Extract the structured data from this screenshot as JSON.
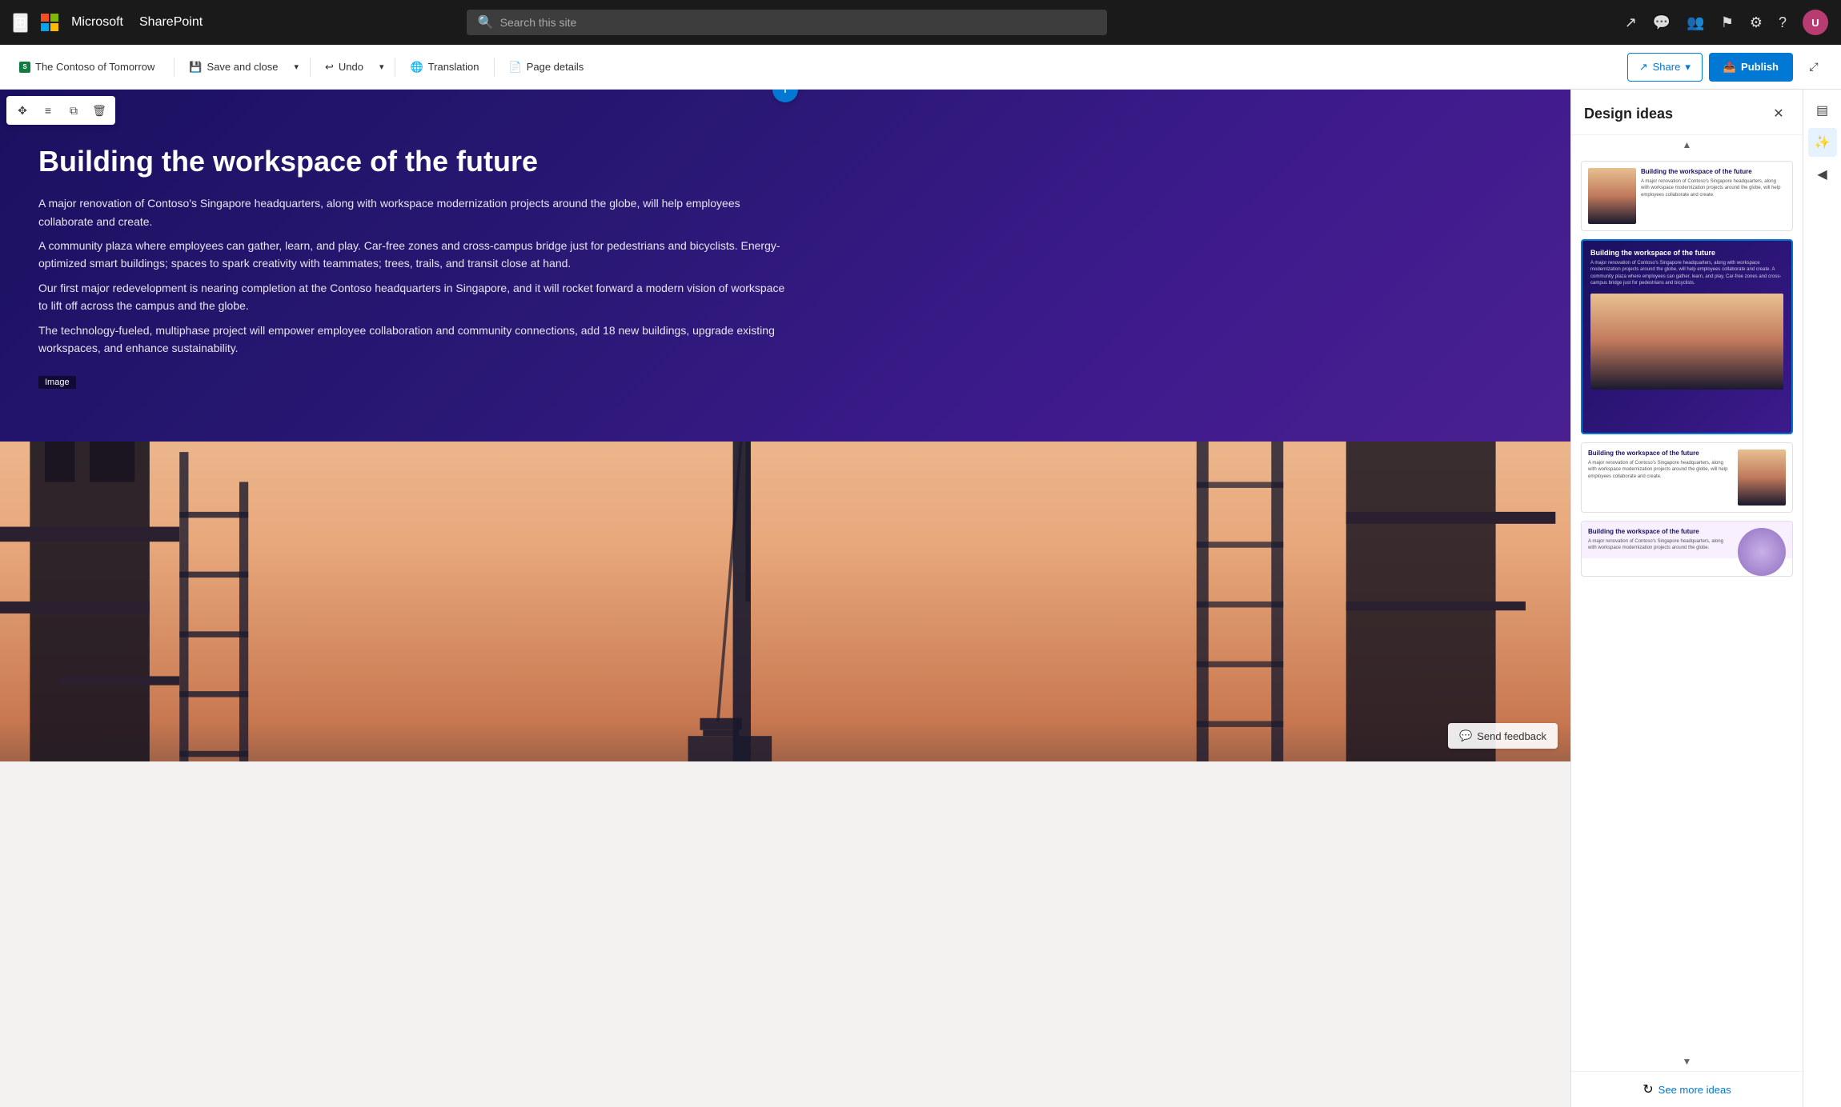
{
  "topnav": {
    "company": "Microsoft",
    "app": "SharePoint",
    "search_placeholder": "Search this site",
    "avatar_initials": "U"
  },
  "toolbar": {
    "brand_label": "The Contoso of Tomorrow",
    "save_close_label": "Save and close",
    "undo_label": "Undo",
    "translation_label": "Translation",
    "page_details_label": "Page details",
    "share_label": "Share",
    "publish_label": "Publish"
  },
  "hero": {
    "title": "Building the workspace of the future",
    "para1": "A major renovation of Contoso's Singapore headquarters, along with workspace modernization projects around the globe, will help employees collaborate and create.",
    "para2": "A community plaza where employees can gather, learn, and play. Car-free zones and cross-campus bridge just for pedestrians and bicyclists. Energy-optimized smart buildings; spaces to spark creativity with teammates; trees, trails, and transit close at hand.",
    "para3": "Our first major redevelopment is nearing completion at the Contoso headquarters in Singapore, and it will rocket forward a modern vision of workspace to lift off across the campus and the globe.",
    "para4": "The technology-fueled, multiphase project will empower employee collaboration and community connections, add 18 new buildings, upgrade existing workspaces, and enhance sustainability.",
    "image_label": "Image",
    "send_feedback_label": "Send feedback"
  },
  "design_panel": {
    "title": "Design ideas",
    "see_more_label": "See more ideas",
    "card1_title": "Building the workspace of the future",
    "card1_text": "A major renovation of Contoso's Singapore headquarters, along with workspace modernization projects around the globe, will help employees collaborate and create.",
    "card2_title": "Building the workspace of the future",
    "card2_text": "A major renovation of Contoso's Singapore headquarters, along with workspace modernization projects around the globe, will help employees collaborate and create. A community plaza where employees can gather, learn, and play. Car-free zones and cross-campus bridge just for pedestrians and bicyclists.",
    "card3_title": "Building the workspace of the future",
    "card3_text": "A major renovation of Contoso's Singapore headquarters, along with workspace modernization projects around the globe, will help employees collaborate and create.",
    "card4_title": "Building the workspace of the future",
    "card4_text": "A major renovation of Contoso's Singapore headquarters, along with workspace modernization projects around the globe."
  },
  "icons": {
    "grid": "⊞",
    "search": "🔍",
    "share_nav": "↗",
    "comment": "💬",
    "people": "👥",
    "flag": "⚑",
    "settings": "⚙",
    "help": "?",
    "save": "💾",
    "undo": "↩",
    "translate": "🌐",
    "page": "📄",
    "share_toolbar": "↗",
    "publish_icon": "📤",
    "chevron_down": "▾",
    "close": "✕",
    "move": "✥",
    "settings2": "≡",
    "copy": "⧉",
    "delete": "🗑",
    "plus": "+",
    "feedback": "💬",
    "refresh": "↻",
    "minimize": "⤢",
    "arrow_up": "▲",
    "arrow_down": "▼",
    "wand": "✨",
    "layout": "▤",
    "right_panel": "▶",
    "collapse": "◀"
  }
}
